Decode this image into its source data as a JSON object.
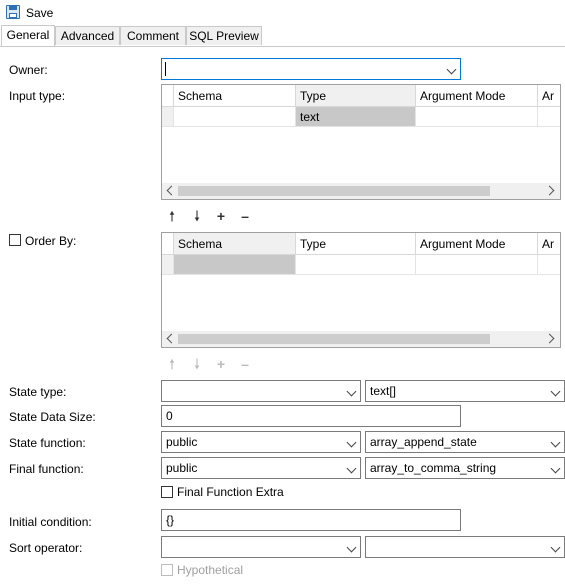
{
  "toolbar": {
    "save_label": "Save"
  },
  "tabs": [
    "General",
    "Advanced",
    "Comment",
    "SQL Preview"
  ],
  "labels": {
    "owner": "Owner:",
    "input_type": "Input type:",
    "order_by": "Order By:",
    "state_type": "State type:",
    "state_data_size": "State Data Size:",
    "state_function": "State function:",
    "final_function": "Final function:",
    "final_function_extra": "Final Function Extra",
    "initial_condition": "Initial condition:",
    "sort_operator": "Sort operator:",
    "hypothetical": "Hypothetical"
  },
  "grid_columns": [
    "Schema",
    "Type",
    "Argument Mode",
    "Ar"
  ],
  "input_type_rows": [
    {
      "schema": "",
      "type": "text",
      "mode": ""
    }
  ],
  "values": {
    "owner": "",
    "state_type_schema": "",
    "state_type_type": "text[]",
    "state_data_size": "0",
    "state_function_schema": "public",
    "state_function_name": "array_append_state",
    "final_function_schema": "public",
    "final_function_name": "array_to_comma_string",
    "initial_condition": "{}",
    "sort_operator_schema": "",
    "sort_operator_name": ""
  },
  "icons": {
    "save": "floppy-disk-icon",
    "up": "arrow-up-icon",
    "down": "arrow-down-icon",
    "add": "plus-icon",
    "remove": "minus-icon"
  }
}
